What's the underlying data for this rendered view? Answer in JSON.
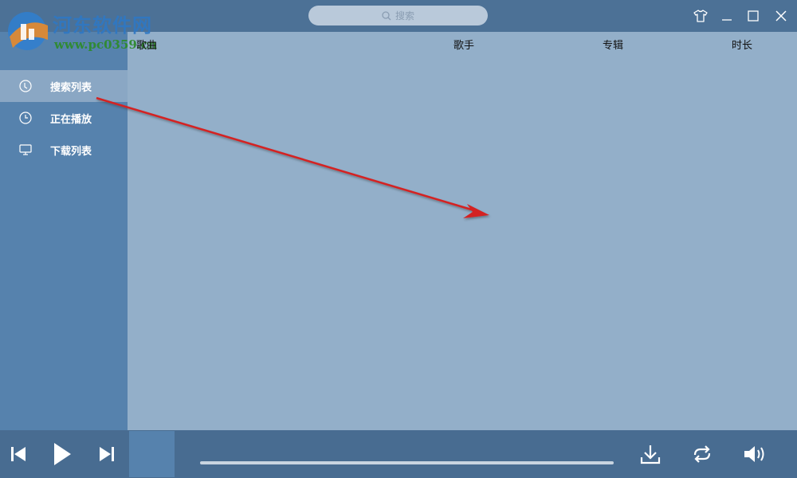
{
  "watermark": {
    "site_name": "河东软件网",
    "url": "www.pc0359.cn"
  },
  "search": {
    "placeholder": "搜索",
    "icon": "search-icon"
  },
  "window_controls": [
    {
      "name": "skin",
      "icon": "tshirt-icon"
    },
    {
      "name": "minimize",
      "icon": "minimize-icon"
    },
    {
      "name": "maximize",
      "icon": "maximize-icon"
    },
    {
      "name": "close",
      "icon": "close-icon"
    }
  ],
  "table": {
    "columns": [
      "歌曲",
      "歌手",
      "专辑",
      "时长"
    ],
    "rows": []
  },
  "sidebar": {
    "items": [
      {
        "label": "搜索列表",
        "icon": "disc-icon",
        "active": true
      },
      {
        "label": "正在播放",
        "icon": "clock-icon",
        "active": false
      },
      {
        "label": "下载列表",
        "icon": "monitor-icon",
        "active": false
      }
    ]
  },
  "player": {
    "progress": 0,
    "controls": [
      "previous-icon",
      "play-icon",
      "next-icon",
      "download-icon",
      "repeat-icon",
      "volume-icon"
    ]
  },
  "colors": {
    "titlebar": "#4c7196",
    "sidebar": "#5682ad",
    "sidebar_active": "#8aa7c4",
    "content": "#93afc9",
    "bottombar": "#486c91",
    "annotation_arrow": "#d42020"
  }
}
